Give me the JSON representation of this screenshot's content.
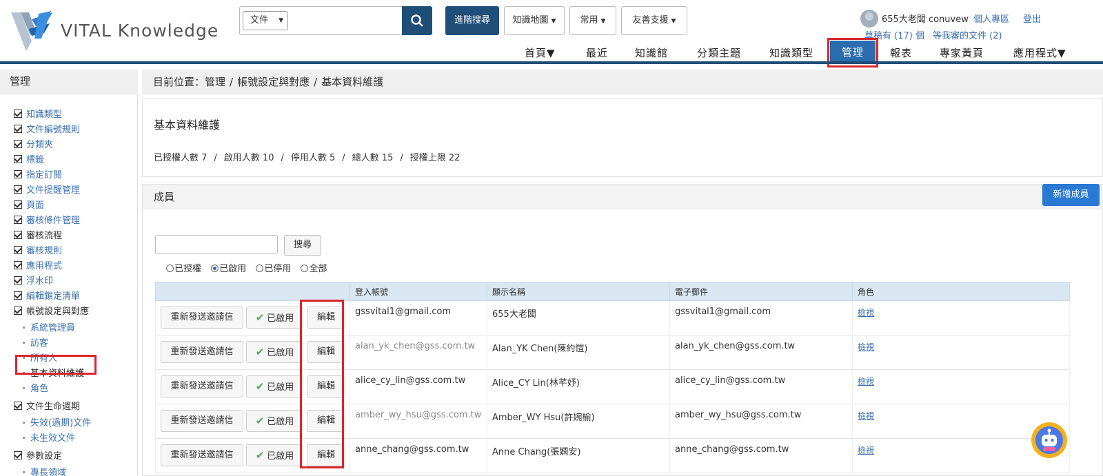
{
  "logo": {
    "text": "VITAL Knowledge"
  },
  "search": {
    "select_value": "文件",
    "placeholder": ""
  },
  "top_buttons": {
    "advanced": "進階搜尋",
    "kmap": "知識地圖",
    "common": "常用",
    "support": "友善支援"
  },
  "user": {
    "name": "655大老闆 conuvew",
    "personal": "個人專區",
    "logout": "登出",
    "drafts": "草稿有 (17) 個",
    "pending": "等我審的文件 (2)"
  },
  "nav": {
    "home": "首頁▼",
    "recent": "最近",
    "library": "知識館",
    "topics": "分類主題",
    "types": "知識類型",
    "manage": "管理",
    "reports": "報表",
    "experts": "專家黃頁",
    "apps": "應用程式▼"
  },
  "sidebar": {
    "title": "管理",
    "items": [
      "知識類型",
      "文件編號規則",
      "分類夾",
      "標籤",
      "指定訂閱",
      "文件提醒管理",
      "頁面",
      "審核條件管理",
      "審核流程",
      "審核規則",
      "應用程式",
      "浮水印",
      "編輯鎖定清單",
      "帳號設定與對應"
    ],
    "account_sub": [
      "系統管理員",
      "訪客",
      "所有人",
      "基本資料維護",
      "角色"
    ],
    "lifecycle": "文件生命週期",
    "lifecycle_sub": [
      "失效(過期)文件",
      "未生效文件"
    ],
    "params": "參數設定",
    "params_sub": [
      "專長領域"
    ]
  },
  "breadcrumb": {
    "prefix": "目前位置：管理",
    "sep": "/",
    "level2": "帳號設定與對應",
    "level3": "基本資料維護"
  },
  "info_panel": {
    "title": "基本資料維護",
    "stats": {
      "authorized": "已授權人數 7",
      "enabled": "啟用人數 10",
      "disabled": "停用人數 5",
      "total": "總人數 15",
      "limit": "授權上限 22"
    },
    "sep": "/"
  },
  "members": {
    "title": "成員",
    "add_button": "新增成員",
    "search_button": "搜尋",
    "search_value": "",
    "filters": [
      "已授權",
      "已啟用",
      "已停用",
      "全部"
    ],
    "headers": [
      "",
      "登入帳號",
      "顯示名稱",
      "電子郵件",
      "角色"
    ],
    "row_buttons": {
      "resend": "重新發送邀請信",
      "enabled": "已啟用",
      "edit": "編輯",
      "view": "檢視"
    },
    "rows": [
      {
        "account": "gssvital1@gmail.com",
        "name": "655大老闆",
        "email": "gssvital1@gmail.com"
      },
      {
        "account": "alan_yk_chen@gss.com.tw",
        "name": "Alan_YK Chen(陳約愷)",
        "email": "alan_yk_chen@gss.com.tw"
      },
      {
        "account": "alice_cy_lin@gss.com.tw",
        "name": "Alice_CY Lin(林芊妤)",
        "email": "alice_cy_lin@gss.com.tw"
      },
      {
        "account": "amber_wy_hsu@gss.com.tw",
        "name": "Amber_WY Hsu(許婉榆)",
        "email": "amber_wy_hsu@gss.com.tw"
      },
      {
        "account": "anne_chang@gss.com.tw",
        "name": "Anne Chang(張嫻安)",
        "email": "anne_chang@gss.com.tw"
      }
    ]
  },
  "colors": {
    "brand": "#1f4e79",
    "accent": "#2a6cae",
    "highlight": "#d9262c"
  },
  "icons": {
    "search": "magnifier-icon",
    "check": "check-icon",
    "bot": "robot-icon"
  }
}
